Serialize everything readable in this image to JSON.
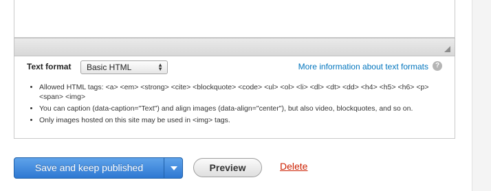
{
  "editor": {
    "resize_icon": "resize-grip-icon"
  },
  "text_format": {
    "label": "Text format",
    "selected": "Basic HTML",
    "more_info_link": "More information about text formats",
    "help_icon": "question-mark-icon",
    "tips": [
      "Allowed HTML tags: <a> <em> <strong> <cite> <blockquote> <code> <ul> <ol> <li> <dl> <dt> <dd> <h4> <h5> <h6> <p> <span> <img>",
      "You can caption (data-caption=\"Text\") and align images (data-align=\"center\"), but also video, blockquotes, and so on.",
      "Only images hosted on this site may be used in <img> tags."
    ]
  },
  "actions": {
    "save_label": "Save and keep published",
    "dropdown_icon": "caret-down-icon",
    "preview_label": "Preview",
    "delete_label": "Delete"
  },
  "colors": {
    "primary_button": "#2e78d2",
    "link": "#0074bd",
    "danger_link": "#cc1f00"
  }
}
